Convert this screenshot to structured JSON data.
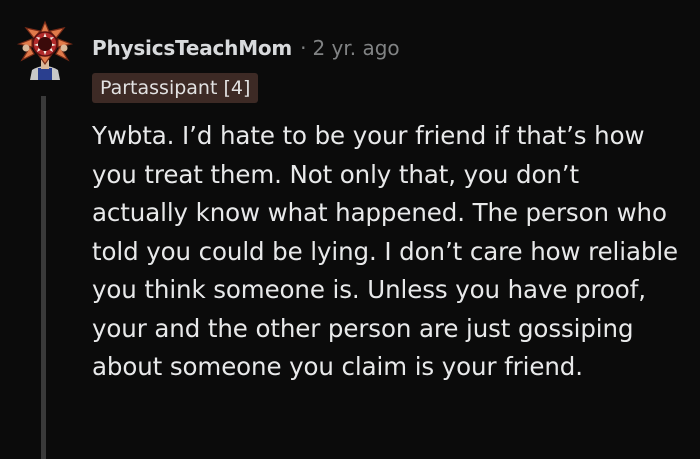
{
  "comment": {
    "username": "PhysicsTeachMom",
    "separator": "·",
    "timestamp": "2 yr. ago",
    "flair": "Partassipant [4]",
    "body": "Ywbta. I’d hate to be your friend if that’s how you treat them. Not only that, you don’t actually know what happened. The person who told you could be lying. I don’t care how reliable you think someone is. Unless you have proof, your and the other person are just gossiping about someone you claim is your friend."
  },
  "colors": {
    "background": "#0b0b0b",
    "username": "#d8dadc",
    "meta": "#818384",
    "flair_bg": "#3d2a25",
    "body_text": "#e8e9ea",
    "thread_line": "#3a3a3a"
  },
  "icons": {
    "avatar": "demogorgon-avatar-icon"
  }
}
